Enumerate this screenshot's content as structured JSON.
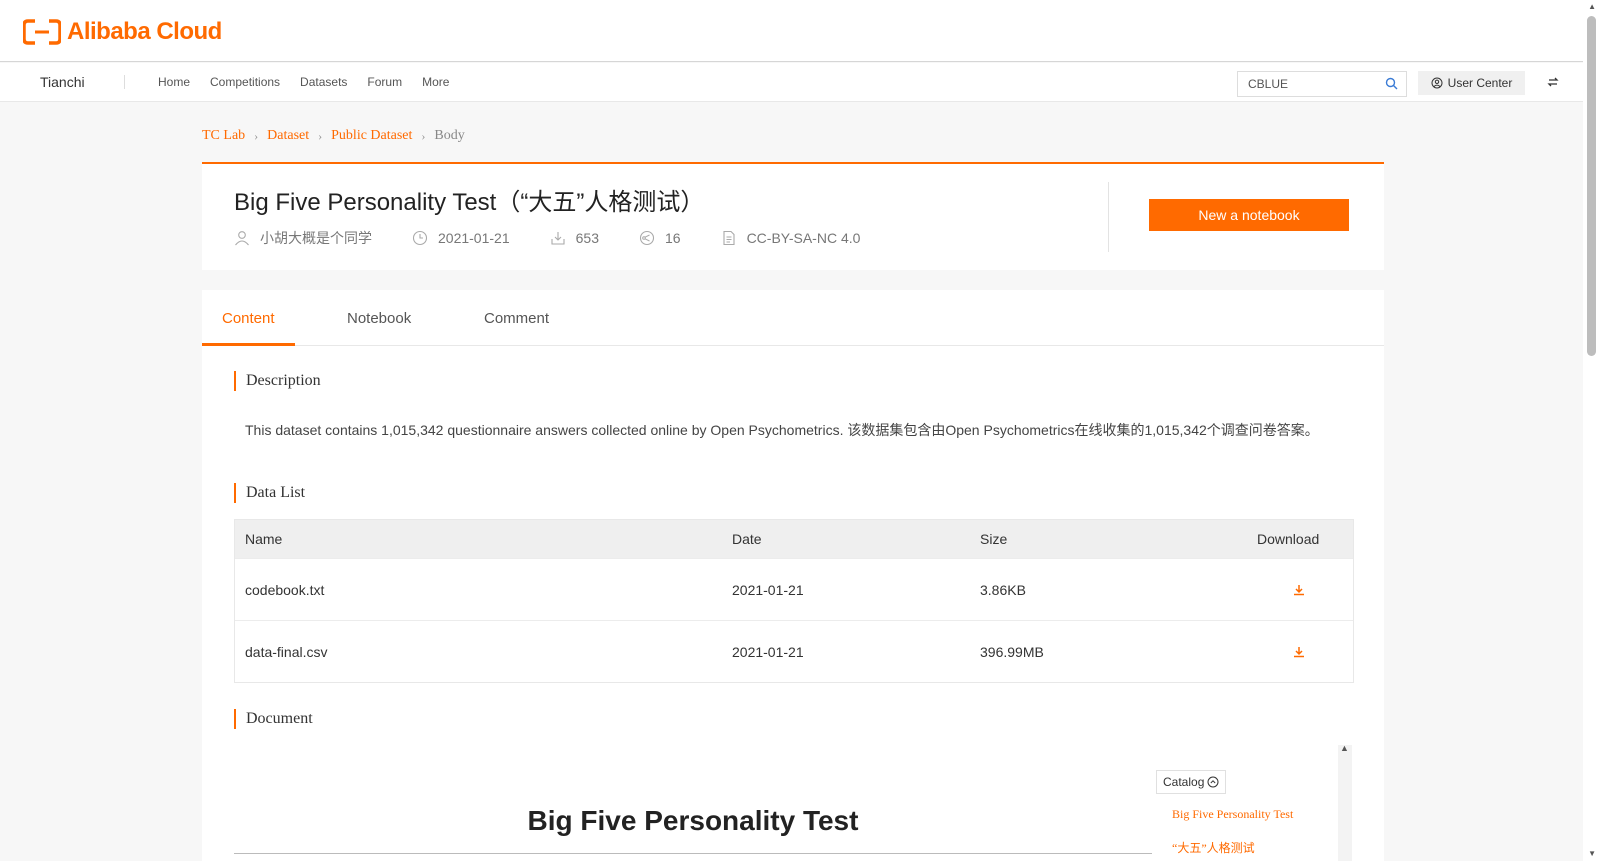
{
  "brand": {
    "logo_text": "Alibaba Cloud",
    "accent": "#ff6a00"
  },
  "nav": {
    "product": "Tianchi",
    "links": [
      "Home",
      "Competitions",
      "Datasets",
      "Forum",
      "More"
    ],
    "search_value": "CBLUE",
    "user_center": "User Center"
  },
  "breadcrumb": [
    "TC Lab",
    "Dataset",
    "Public Dataset",
    "Body"
  ],
  "dataset": {
    "title": "Big Five Personality Test（“大五”人格测试）",
    "author": "小胡大概是个同学",
    "date": "2021-01-21",
    "downloads": "653",
    "shares": "16",
    "license": "CC-BY-SA-NC 4.0",
    "new_notebook": "New a notebook"
  },
  "tabs": [
    "Content",
    "Notebook",
    "Comment"
  ],
  "sections": {
    "description": "Description",
    "description_text": "This dataset contains 1,015,342 questionnaire answers collected online by Open Psychometrics. 该数据集包含由Open Psychometrics在线收集的1,015,342个调查问卷答案。",
    "data_list": "Data List",
    "document": "Document"
  },
  "table": {
    "headers": [
      "Name",
      "Date",
      "Size",
      "Download"
    ],
    "rows": [
      {
        "name": "codebook.txt",
        "date": "2021-01-21",
        "size": "3.86KB"
      },
      {
        "name": "data-final.csv",
        "date": "2021-01-21",
        "size": "396.99MB"
      }
    ]
  },
  "document": {
    "heading": "Big Five Personality Test",
    "catalog_label": "Catalog",
    "catalog_items": [
      "Big Five Personality Test",
      "“大五”人格测试"
    ]
  }
}
